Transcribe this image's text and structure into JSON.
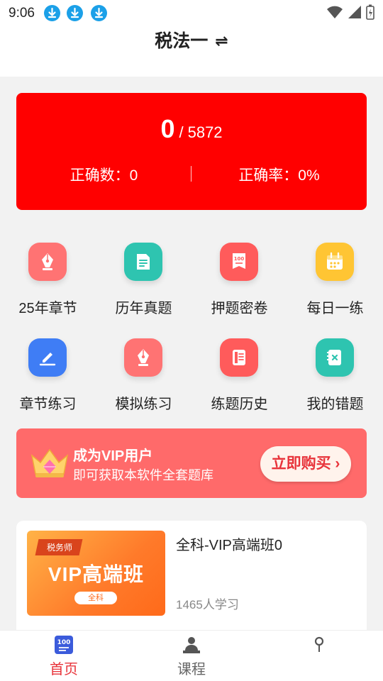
{
  "status": {
    "time": "9:06"
  },
  "header": {
    "title": "税法一",
    "swap_symbol": "⇌"
  },
  "stats": {
    "answered": "0",
    "separator": "/",
    "total": "5872",
    "correct_count": "正确数：0",
    "correct_rate": "正确率：0%"
  },
  "grid": [
    {
      "label": "25年章节",
      "icon": "pen-icon",
      "color": "#ff7070"
    },
    {
      "label": "历年真题",
      "icon": "document-icon",
      "color": "#2ec4b0"
    },
    {
      "label": "押题密卷",
      "icon": "exam-100-icon",
      "color": "#ff5b5b"
    },
    {
      "label": "每日一练",
      "icon": "calendar-icon",
      "color": "#ffc533"
    },
    {
      "label": "章节练习",
      "icon": "edit-icon",
      "color": "#3f7df5"
    },
    {
      "label": "模拟练习",
      "icon": "pen-icon",
      "color": "#ff7070"
    },
    {
      "label": "练题历史",
      "icon": "notes-icon",
      "color": "#ff5b5b"
    },
    {
      "label": "我的错题",
      "icon": "wrong-book-icon",
      "color": "#2ec4b0"
    }
  ],
  "vip": {
    "title": "成为VIP用户",
    "subtitle": "即可获取本软件全套题库",
    "button": "立即购买 ›"
  },
  "course": {
    "thumb_tag": "税务师",
    "thumb_title": "VIP高端班",
    "thumb_pill": "全科",
    "name": "全科-VIP高端班0",
    "learners": "1465人学习"
  },
  "nav": [
    {
      "label": "首页",
      "icon": "home-100-icon",
      "active": true
    },
    {
      "label": "课程",
      "icon": "teacher-icon",
      "active": false
    },
    {
      "label": "",
      "icon": "profile-icon",
      "active": false
    }
  ],
  "colors": {
    "accent": "#ff0000",
    "nav_active": "#e8333a",
    "vip_bg": "#ff6a6a"
  }
}
